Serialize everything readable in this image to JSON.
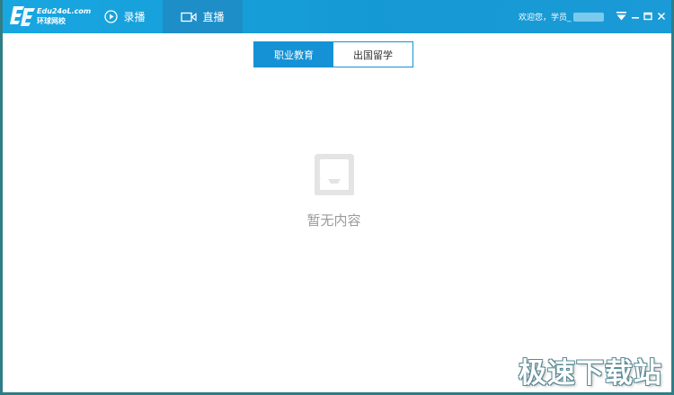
{
  "app": {
    "logo_line1": "Edu24oL.com",
    "logo_line2": "环球网校"
  },
  "nav": {
    "record_label": "录播",
    "live_label": "直播"
  },
  "user": {
    "greeting": "欢迎您，学员_"
  },
  "segments": {
    "vocational": "职业教育",
    "abroad": "出国留学"
  },
  "empty_state": {
    "message": "暂无内容"
  },
  "watermark": "极速下载站",
  "colors": {
    "titlebar": "#1aa2dd",
    "accent": "#1592d5",
    "muted_text": "#9b9b9b"
  }
}
